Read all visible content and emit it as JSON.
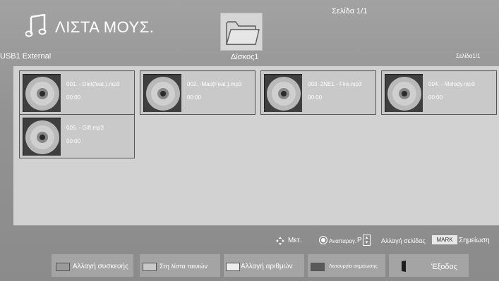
{
  "header": {
    "title": "ΛΙΣΤΑ ΜΟΥΣ.",
    "page_top": "Σελίδα 1/1",
    "device": "USB1 External",
    "disk": "Δίσκος1",
    "page_right": "Σελίδα1/1"
  },
  "files": [
    {
      "name": "001. - Diet(feat.).mp3",
      "time": "00:00"
    },
    {
      "name": "002. -Mad(Feat.).mp3",
      "time": "00:00"
    },
    {
      "name": "003. 2NE1 - Fire.mp3",
      "time": "00:00"
    },
    {
      "name": "004. - Melody.mp3",
      "time": "00:00"
    },
    {
      "name": "005. - Gift.mp3",
      "time": "00:00"
    }
  ],
  "hints": {
    "move": "Μετ.",
    "play": "Αναπαραγ.",
    "p_label": "P",
    "page_change": "Αλλαγή σελίδας",
    "mark_key": "MARK",
    "mark": "Σημείωση"
  },
  "buttons": {
    "change_device": "Αλλαγή συσκευής",
    "movie_list": "Στη λίστα ταινιών",
    "change_numbers": "Αλλαγή αριθμών",
    "mark_mode": "Λειτουργία σημείωσης",
    "exit": "Έξοδος"
  },
  "colors": {
    "swatch_red": "#9a9a9a",
    "swatch_green": "#c8c8c8",
    "swatch_yellow": "#eeeeee",
    "swatch_blue": "#5a5a5a"
  }
}
